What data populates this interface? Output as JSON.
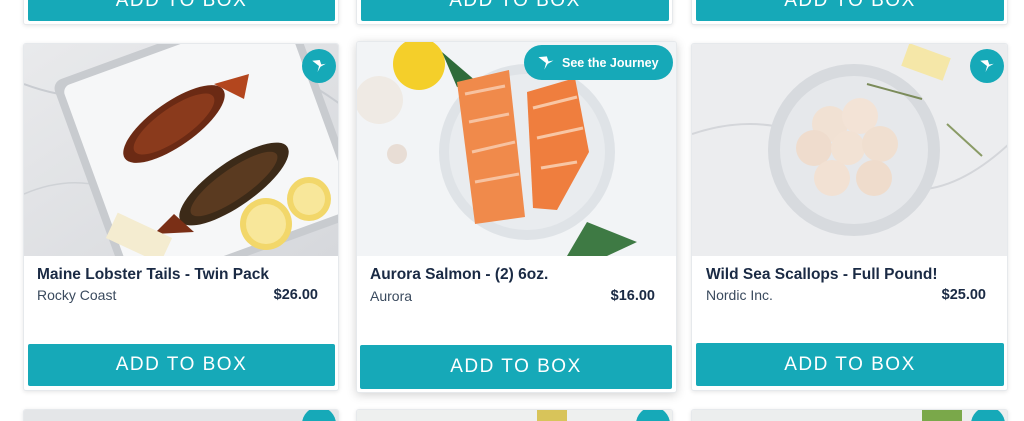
{
  "colors": {
    "accent": "#16a9b8",
    "title": "#1a2a44",
    "muted": "#3a4a5e"
  },
  "icons": {
    "journey": "hummingbird-icon"
  },
  "top_row": {
    "button_label": "ADD TO BOX"
  },
  "products": [
    {
      "title": "Maine Lobster Tails - Twin Pack",
      "vendor": "Rocky Coast",
      "price": "$26.00",
      "button_label": "ADD TO BOX"
    },
    {
      "title": "Aurora Salmon - (2) 6oz.",
      "vendor": "Aurora",
      "price": "$16.00",
      "button_label": "ADD TO BOX",
      "journey_label": "See the Journey"
    },
    {
      "title": "Wild Sea Scallops - Full Pound!",
      "vendor": "Nordic Inc.",
      "price": "$25.00",
      "button_label": "ADD TO BOX"
    }
  ]
}
